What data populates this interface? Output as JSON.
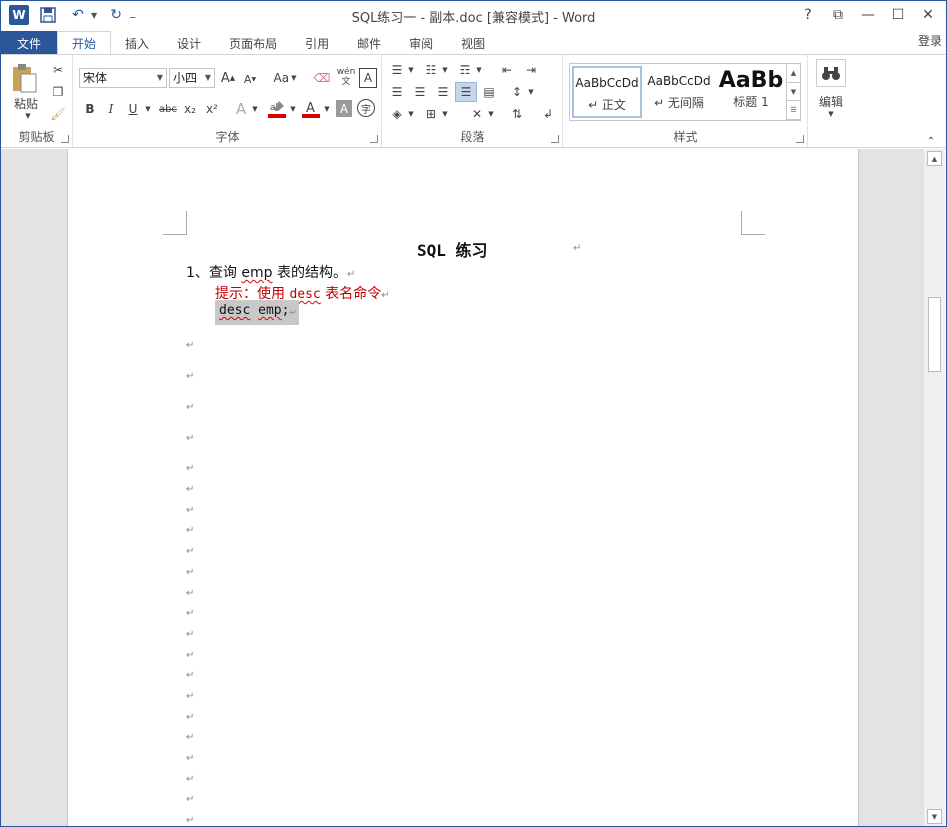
{
  "window": {
    "title": "SQL练习一 - 副本.doc [兼容模式] - Word",
    "app_icon": "W",
    "controls": [
      "?",
      "⧉",
      "—",
      "☐",
      "✕"
    ]
  },
  "tabs": {
    "file": "文件",
    "home": "开始",
    "insert": "插入",
    "design": "设计",
    "layout": "页面布局",
    "references": "引用",
    "mailings": "邮件",
    "review": "审阅",
    "view": "视图",
    "login": "登录"
  },
  "ribbon": {
    "clipboard": {
      "label": "剪贴板",
      "paste": "粘贴"
    },
    "font": {
      "label": "字体",
      "font_name": "宋体",
      "font_size": "小四",
      "case_btn": "Aa",
      "bold": "B",
      "italic": "I",
      "underline": "U",
      "strike": "abc",
      "subscript": "x₂",
      "superscript": "x²",
      "phonetic": "wén",
      "phonetic_sub": "文"
    },
    "paragraph": {
      "label": "段落"
    },
    "styles": {
      "label": "样式",
      "items": [
        {
          "sample": "AaBbCcDd",
          "name": "↵ 正文"
        },
        {
          "sample": "AaBbCcDd",
          "name": "↵ 无间隔"
        },
        {
          "sample": "AaBb",
          "name": "标题 1"
        }
      ]
    },
    "editing": {
      "label": "编辑"
    }
  },
  "document": {
    "title": "SQL 练习",
    "item1_number": "1、",
    "item1_text_a": "查询 ",
    "item1_text_b": "emp",
    "item1_text_c": " 表的结构。",
    "hint_a": "提示：使用 ",
    "hint_b": "desc",
    "hint_c": " 表名命令",
    "code_a": "desc",
    "code_b": " ",
    "code_c": "emp",
    "code_d": ";",
    "para_mark": "↵"
  }
}
